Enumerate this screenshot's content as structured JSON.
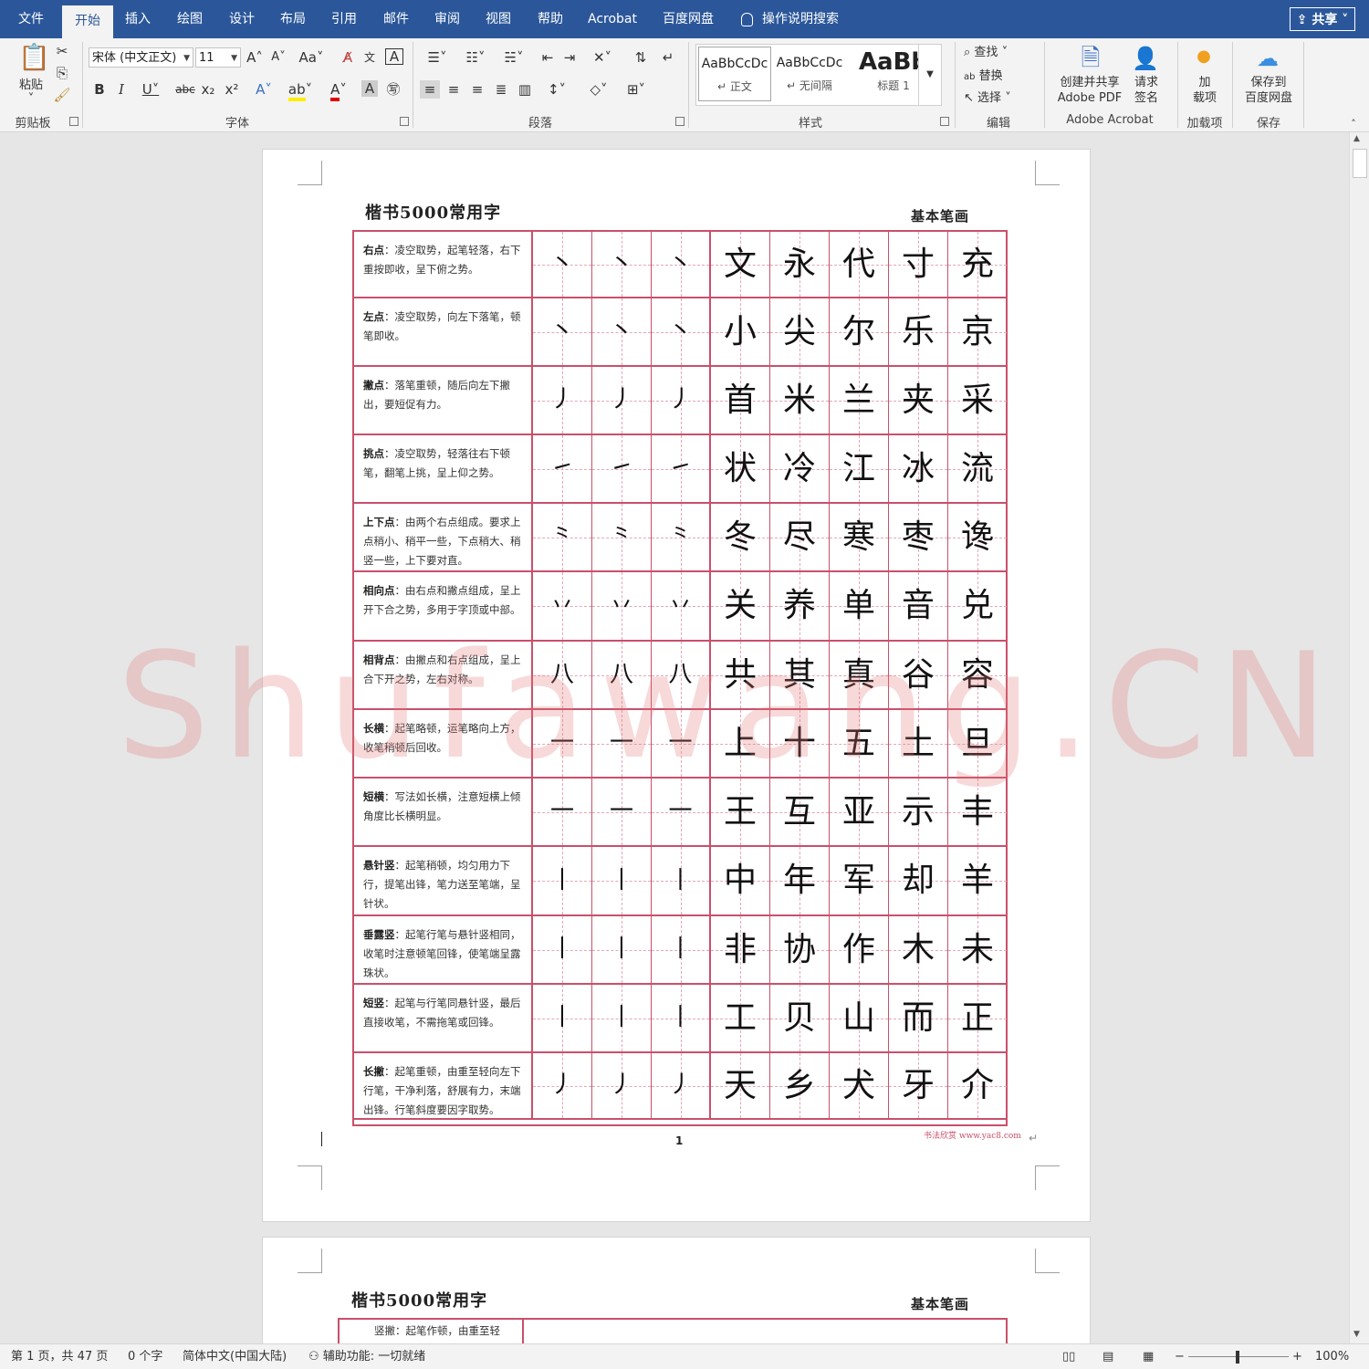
{
  "menu": {
    "tabs": [
      "文件",
      "开始",
      "插入",
      "绘图",
      "设计",
      "布局",
      "引用",
      "邮件",
      "审阅",
      "视图",
      "帮助",
      "Acrobat",
      "百度网盘"
    ],
    "active_tab": "开始",
    "search_text": "操作说明搜索",
    "share_label": "共享"
  },
  "ribbon": {
    "clipboard": {
      "paste_label": "粘贴",
      "group_label": "剪贴板"
    },
    "font": {
      "font_name": "宋体 (中文正文)",
      "font_size": "11",
      "case_label": "Aa",
      "group_label": "字体"
    },
    "paragraph": {
      "group_label": "段落"
    },
    "styles": {
      "items": [
        {
          "preview": "AaBbCcDc",
          "name": "正文"
        },
        {
          "preview": "AaBbCcDc",
          "name": "无间隔"
        },
        {
          "preview": "AaBb",
          "name": "标题 1"
        }
      ],
      "group_label": "样式"
    },
    "editing": {
      "find_label": "查找",
      "replace_label": "替换",
      "select_label": "选择",
      "group_label": "编辑"
    },
    "acrobat": {
      "create_share_label": "创建并共享",
      "create_share_label2": "Adobe PDF",
      "request_sign_label": "请求",
      "request_sign_label2": "签名",
      "group_label": "Adobe Acrobat"
    },
    "addins": {
      "label": "加",
      "label2": "载项",
      "group_label": "加载项"
    },
    "save": {
      "label": "保存到",
      "label2": "百度网盘",
      "group_label": "保存"
    }
  },
  "document": {
    "sheet_title": "楷书5000常用字",
    "sheet_subtitle": "基本笔画",
    "page_number": "1",
    "site_credit": "书法欣赏 www.yac8.com",
    "watermark": "Shufawang.CN",
    "rows": [
      {
        "term": "右点",
        "desc": "：凌空取势，起笔轻落，右下重按即收，呈下俯之势。",
        "stroke": "丶",
        "chars": [
          "文",
          "永",
          "代",
          "寸",
          "充"
        ]
      },
      {
        "term": "左点",
        "desc": "：凌空取势，向左下落笔，顿笔即收。",
        "stroke": "丶",
        "chars": [
          "小",
          "尖",
          "尔",
          "乐",
          "京"
        ]
      },
      {
        "term": "撇点",
        "desc": "：落笔重顿，随后向左下撇出，要短促有力。",
        "stroke": "丿",
        "chars": [
          "首",
          "米",
          "兰",
          "夹",
          "采"
        ]
      },
      {
        "term": "挑点",
        "desc": "：凌空取势，轻落往右下顿笔，翻笔上挑，呈上仰之势。",
        "stroke": "㇀",
        "chars": [
          "状",
          "冷",
          "江",
          "冰",
          "流"
        ]
      },
      {
        "term": "上下点",
        "desc": "：由两个右点组成。要求上点稍小、稍平一些，下点稍大、稍竖一些，上下要对直。",
        "stroke": "⺀",
        "chars": [
          "冬",
          "尽",
          "寒",
          "枣",
          "谗"
        ]
      },
      {
        "term": "相向点",
        "desc": "：由右点和撇点组成，呈上开下合之势，多用于字顶或中部。",
        "stroke": "丷",
        "chars": [
          "关",
          "养",
          "单",
          "音",
          "兑"
        ]
      },
      {
        "term": "相背点",
        "desc": "：由撇点和右点组成，呈上合下开之势，左右对称。",
        "stroke": "八",
        "chars": [
          "共",
          "其",
          "真",
          "谷",
          "容"
        ]
      },
      {
        "term": "长横",
        "desc": "：起笔略顿，运笔略向上方，收笔稍顿后回收。",
        "stroke": "一",
        "chars": [
          "上",
          "十",
          "五",
          "土",
          "旦"
        ]
      },
      {
        "term": "短横",
        "desc": "：写法如长横，注意短横上倾角度比长横明显。",
        "stroke": "一",
        "chars": [
          "王",
          "互",
          "亚",
          "示",
          "丰"
        ]
      },
      {
        "term": "悬针竖",
        "desc": "：起笔稍顿，均匀用力下行，提笔出锋，笔力送至笔端，呈针状。",
        "stroke": "丨",
        "chars": [
          "中",
          "年",
          "军",
          "却",
          "羊"
        ]
      },
      {
        "term": "垂露竖",
        "desc": "：起笔行笔与悬针竖相同，收笔时注意顿笔回锋，使笔端呈露珠状。",
        "stroke": "丨",
        "chars": [
          "非",
          "协",
          "作",
          "木",
          "未"
        ]
      },
      {
        "term": "短竖",
        "desc": "：起笔与行笔同悬针竖，最后直接收笔，不需拖笔或回锋。",
        "stroke": "丨",
        "chars": [
          "工",
          "贝",
          "山",
          "而",
          "正"
        ]
      },
      {
        "term": "长撇",
        "desc": "：起笔重顿，由重至轻向左下行笔，干净利落，舒展有力，末端出锋。行笔斜度要因字取势。",
        "stroke": "丿",
        "chars": [
          "天",
          "乡",
          "犬",
          "牙",
          "介"
        ]
      }
    ],
    "page2": {
      "sheet_title": "楷书5000常用字",
      "sheet_subtitle": "基本笔画",
      "first_row_desc": "竖撇：起笔作顿，由重至轻"
    }
  },
  "status": {
    "page_info": "第 1 页，共 47 页",
    "word_count": "0 个字",
    "language": "简体中文(中国大陆)",
    "accessibility": "辅助功能: 一切就绪",
    "zoom": "100%"
  },
  "colors": {
    "brand": "#2b579a",
    "grid": "#c9506b",
    "watermark": "#e27878"
  }
}
